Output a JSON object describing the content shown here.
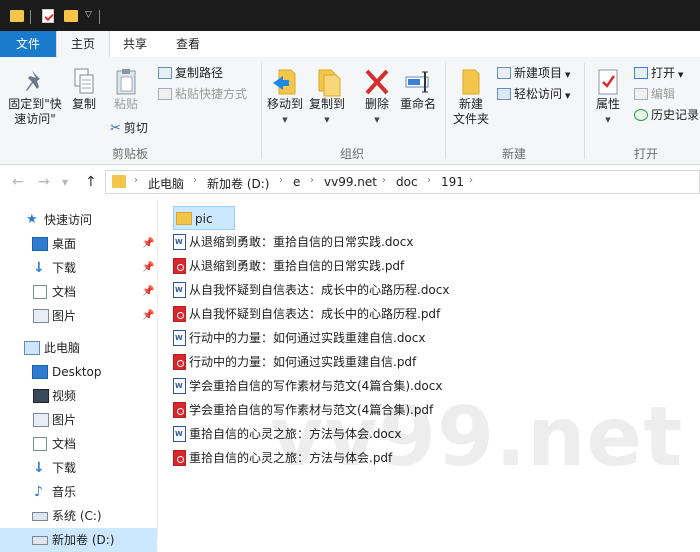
{
  "tabs": {
    "file": "文件",
    "home": "主页",
    "share": "共享",
    "view": "查看"
  },
  "ribbon": {
    "clipboard": {
      "pin": "固定到\"快速访问\"",
      "copy": "复制",
      "paste": "粘贴",
      "copy_path": "复制路径",
      "paste_shortcut": "粘贴快捷方式",
      "cut": "剪切",
      "label": "剪贴板"
    },
    "organize": {
      "move_to": "移动到",
      "copy_to": "复制到",
      "delete": "删除",
      "rename": "重命名",
      "label": "组织"
    },
    "new": {
      "new_folder": "新建\n文件夹",
      "new_item": "新建项目",
      "easy_access": "轻松访问",
      "label": "新建"
    },
    "open": {
      "properties": "属性",
      "open": "打开",
      "edit": "编辑",
      "history": "历史记录",
      "label": "打开"
    }
  },
  "address": {
    "crumbs": [
      "此电脑",
      "新加卷 (D:)",
      "e",
      "vv99.net",
      "doc",
      "191"
    ]
  },
  "nav": {
    "quick_access": "快速访问",
    "desktop": "桌面",
    "downloads": "下载",
    "documents": "文档",
    "pictures": "图片",
    "this_pc": "此电脑",
    "pc_desktop": "Desktop",
    "pc_videos": "视频",
    "pc_pictures": "图片",
    "pc_documents": "文档",
    "pc_downloads": "下载",
    "pc_music": "音乐",
    "system_c": "系统 (C:)",
    "new_vol_d": "新加卷 (D:)"
  },
  "files": [
    {
      "name": "pic",
      "type": "folder"
    },
    {
      "name": "从退缩到勇敢：重拾自信的日常实践.docx",
      "type": "docx"
    },
    {
      "name": "从退缩到勇敢：重拾自信的日常实践.pdf",
      "type": "pdf"
    },
    {
      "name": "从自我怀疑到自信表达：成长中的心路历程.docx",
      "type": "docx"
    },
    {
      "name": "从自我怀疑到自信表达：成长中的心路历程.pdf",
      "type": "pdf"
    },
    {
      "name": "行动中的力量：如何通过实践重建自信.docx",
      "type": "docx"
    },
    {
      "name": "行动中的力量：如何通过实践重建自信.pdf",
      "type": "pdf"
    },
    {
      "name": "学会重拾自信的写作素材与范文(4篇合集).docx",
      "type": "docx"
    },
    {
      "name": "学会重拾自信的写作素材与范文(4篇合集).pdf",
      "type": "pdf"
    },
    {
      "name": "重拾自信的心灵之旅：方法与体会.docx",
      "type": "docx"
    },
    {
      "name": "重拾自信的心灵之旅：方法与体会.pdf",
      "type": "pdf"
    }
  ],
  "watermark": "vv99.net"
}
